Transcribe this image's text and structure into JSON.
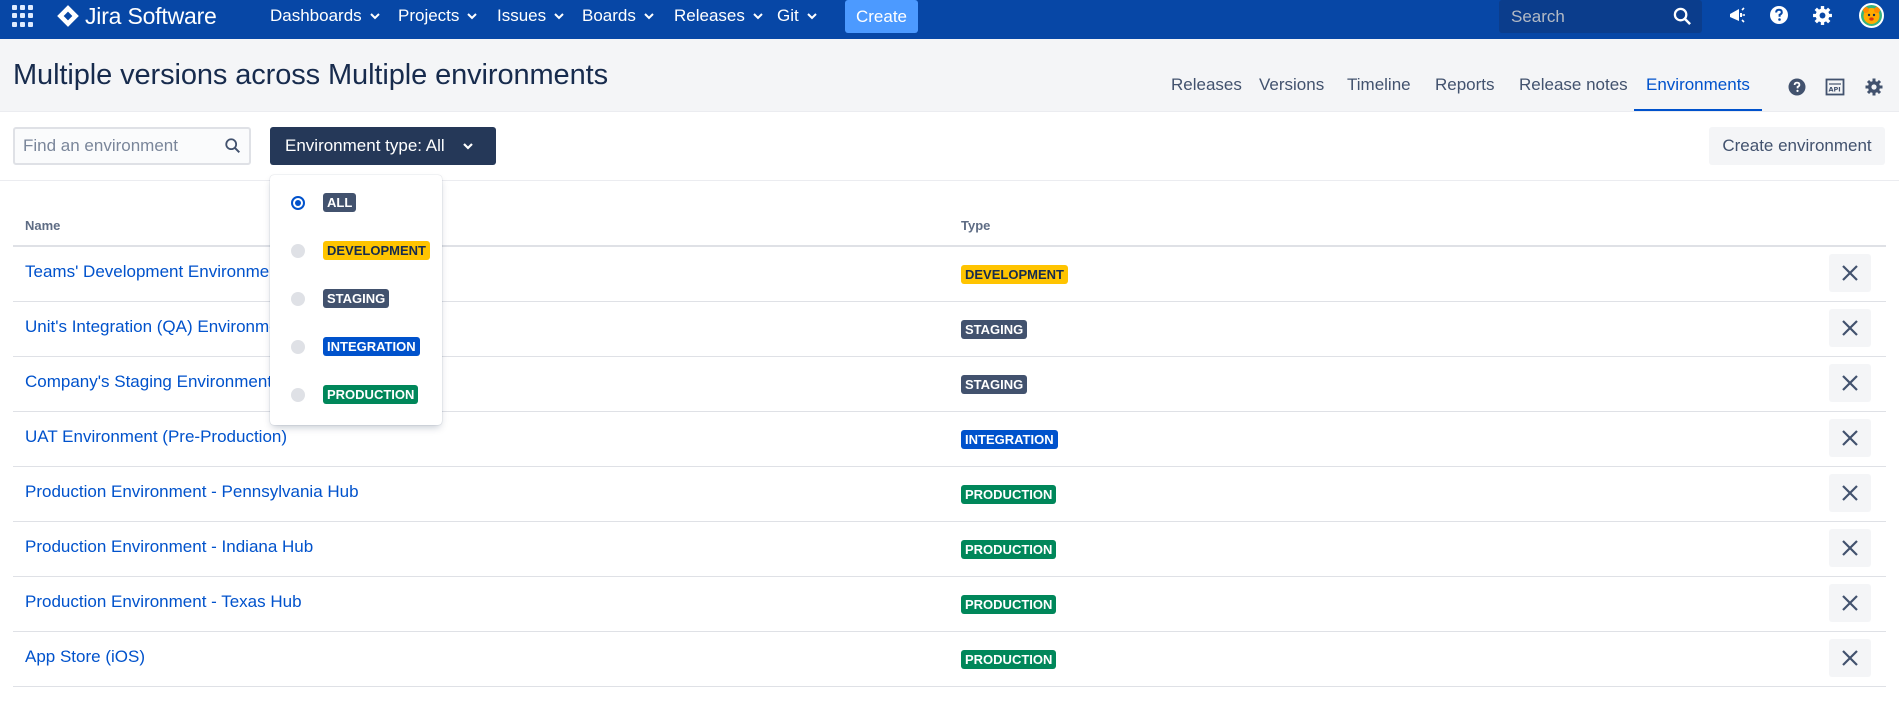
{
  "topnav": {
    "brand": "Jira Software",
    "menu": [
      "Dashboards",
      "Projects",
      "Issues",
      "Boards",
      "Releases",
      "Git"
    ],
    "create_label": "Create",
    "search_placeholder": "Search",
    "icons": [
      "app-switcher-icon",
      "notifications-icon",
      "help-icon",
      "settings-icon",
      "avatar"
    ]
  },
  "header": {
    "title": "Multiple versions across Multiple environments",
    "tabs": [
      "Releases",
      "Versions",
      "Timeline",
      "Reports",
      "Release notes",
      "Environments"
    ],
    "active_tab": "Environments",
    "icons": [
      "help-icon",
      "api-icon",
      "settings-icon"
    ]
  },
  "toolbar": {
    "find_placeholder": "Find an environment",
    "env_type_label": "Environment type: All",
    "create_env_label": "Create environment"
  },
  "dropdown": {
    "options": [
      {
        "label": "ALL",
        "kind": "staging",
        "checked": true
      },
      {
        "label": "DEVELOPMENT",
        "kind": "development",
        "checked": false
      },
      {
        "label": "STAGING",
        "kind": "staging",
        "checked": false
      },
      {
        "label": "INTEGRATION",
        "kind": "integration",
        "checked": false
      },
      {
        "label": "PRODUCTION",
        "kind": "production",
        "checked": false
      }
    ]
  },
  "table": {
    "columns": [
      "Name",
      "Type"
    ],
    "rows": [
      {
        "name": "Teams' Development Environment",
        "type": "DEVELOPMENT"
      },
      {
        "name": "Unit's Integration (QA) Environment",
        "type": "STAGING"
      },
      {
        "name": "Company's Staging Environment",
        "type": "STAGING"
      },
      {
        "name": "UAT Environment (Pre-Production)",
        "type": "INTEGRATION"
      },
      {
        "name": "Production Environment - Pennsylvania Hub",
        "type": "PRODUCTION"
      },
      {
        "name": "Production Environment - Indiana Hub",
        "type": "PRODUCTION"
      },
      {
        "name": "Production Environment - Texas Hub",
        "type": "PRODUCTION"
      },
      {
        "name": "App Store (iOS)",
        "type": "PRODUCTION"
      }
    ]
  },
  "colors": {
    "nav_bg": "#0747a6",
    "accent": "#0052cc",
    "development": "#ffc400",
    "staging": "#42526e",
    "integration": "#0052cc",
    "production": "#00875a"
  }
}
